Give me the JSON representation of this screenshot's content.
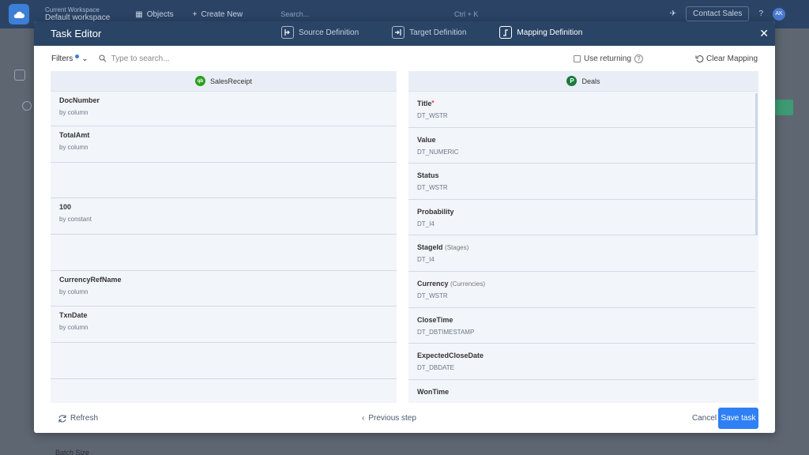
{
  "background": {
    "workspace_caption": "Current Workspace",
    "workspace_name": "Default workspace",
    "nav_objects": "Objects",
    "nav_create": "Create New",
    "search_placeholder": "Search...",
    "search_shortcut": "Ctrl + K",
    "contact_sales": "Contact Sales",
    "avatar_initials": "AK",
    "batch_size_label": "Batch Size"
  },
  "modal": {
    "title": "Task Editor",
    "steps": [
      {
        "label": "Source Definition",
        "icon": "source-definition-icon"
      },
      {
        "label": "Target Definition",
        "icon": "target-definition-icon"
      },
      {
        "label": "Mapping Definition",
        "icon": "mapping-definition-icon",
        "active": true
      }
    ]
  },
  "toolbar": {
    "filters_label": "Filters",
    "search_placeholder": "Type to search...",
    "use_returning_label": "Use returning",
    "clear_mapping_label": "Clear Mapping"
  },
  "source_panel": {
    "title": "SalesReceipt",
    "icon_text": "qb",
    "rows": [
      {
        "name": "DocNumber",
        "desc": "by column"
      },
      {
        "name": "TotalAmt",
        "desc": "by column"
      },
      {
        "name": "",
        "desc": ""
      },
      {
        "name": "100",
        "desc": "by constant"
      },
      {
        "name": "",
        "desc": ""
      },
      {
        "name": "CurrencyRefName",
        "desc": "by column"
      },
      {
        "name": "TxnDate",
        "desc": "by column"
      },
      {
        "name": "",
        "desc": ""
      },
      {
        "name": "",
        "desc": ""
      }
    ]
  },
  "target_panel": {
    "title": "Deals",
    "icon_text": "P",
    "rows": [
      {
        "name": "Title",
        "required": "*",
        "sub": "",
        "type": "DT_WSTR"
      },
      {
        "name": "Value",
        "required": "",
        "sub": "",
        "type": "DT_NUMERIC"
      },
      {
        "name": "Status",
        "required": "",
        "sub": "",
        "type": "DT_WSTR"
      },
      {
        "name": "Probability",
        "required": "",
        "sub": "",
        "type": "DT_I4"
      },
      {
        "name": "StageId",
        "required": "",
        "sub": "(Stages)",
        "type": "DT_I4"
      },
      {
        "name": "Currency",
        "required": "",
        "sub": "(Currencies)",
        "type": "DT_WSTR"
      },
      {
        "name": "CloseTime",
        "required": "",
        "sub": "",
        "type": "DT_DBTIMESTAMP"
      },
      {
        "name": "ExpectedCloseDate",
        "required": "",
        "sub": "",
        "type": "DT_DBDATE"
      },
      {
        "name": "WonTime",
        "required": "",
        "sub": "",
        "type": ""
      }
    ]
  },
  "footer": {
    "refresh_label": "Refresh",
    "previous_label": "Previous step",
    "cancel_label": "Cancel",
    "save_label": "Save task"
  },
  "colors": {
    "header": "#2a4466",
    "primary": "#2f7ff5",
    "quickbooks": "#2ca01c",
    "pipedrive": "#1a7a3e"
  }
}
